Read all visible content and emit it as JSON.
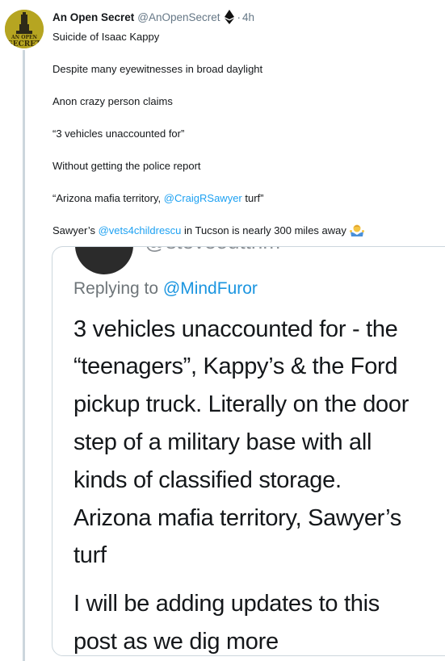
{
  "author": {
    "name": "An Open Secret",
    "handle": "@AnOpenSecret",
    "separator": "·",
    "time": "4h",
    "avatar_text": [
      "AN OPEN",
      "SECRET"
    ],
    "verified_icon": "ethereum-diamond-icon"
  },
  "tweet_lines": [
    {
      "text": "Suicide of Isaac Kappy"
    },
    {
      "text": "Despite many eyewitnesses in broad daylight"
    },
    {
      "text": "Anon crazy person claims"
    },
    {
      "text": "“3 vehicles unaccounted for”"
    },
    {
      "text": "Without getting the police report"
    },
    {
      "pre": "“Arizona mafia territory, ",
      "mention": "@CraigRSawyer",
      "post": " turf”"
    },
    {
      "pre": "Sawyer’s ",
      "mention": "@vets4childrescu",
      "post": " in Tucson is nearly 300 miles away",
      "emoji": "man-shrugging-emoji"
    }
  ],
  "embedded": {
    "handle": "@steveouttrim",
    "replying_prefix": "Replying to ",
    "replying_to": "@MindFuror",
    "body_lines": [
      "3 vehicles unaccounted for - the",
      "“teenagers”, Kappy’s & the Ford",
      "pickup truck. Literally on the door",
      "step of a military base with all",
      "kinds of classified storage.",
      "Arizona mafia territory, Sawyer’s",
      "turf",
      "I will be adding updates to this",
      "post as we dig more"
    ]
  },
  "colors": {
    "mention": "#1da1f2",
    "secondary_text": "#657786",
    "avatar_bg": "#b6a521"
  }
}
